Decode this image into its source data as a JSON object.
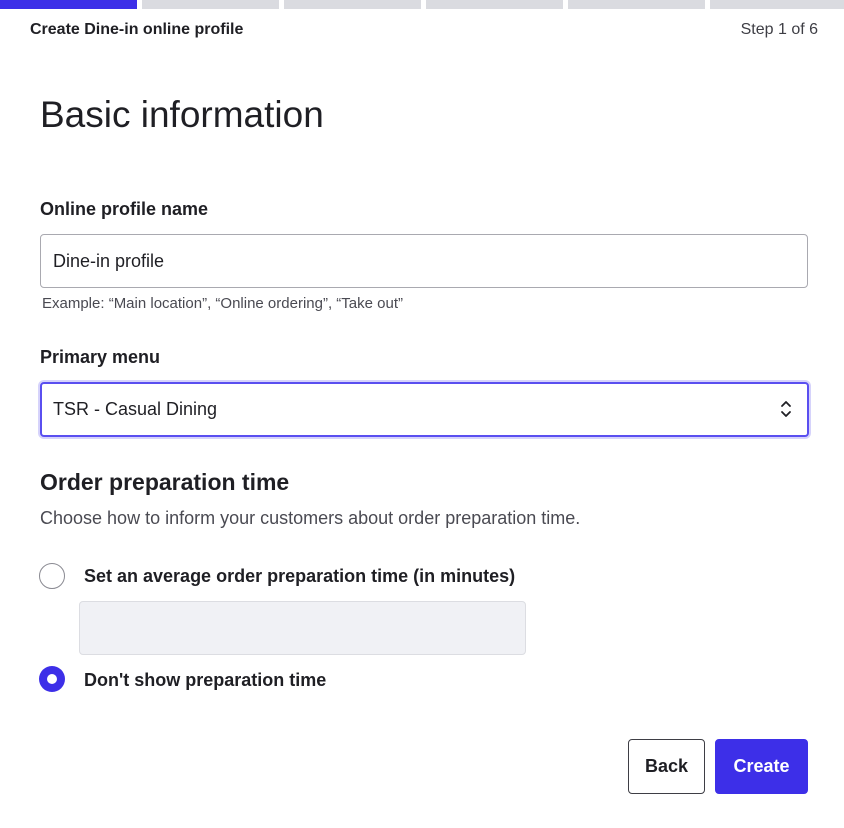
{
  "progress": {
    "total_steps": 6,
    "current_step": 1
  },
  "header": {
    "title": "Create Dine-in online profile",
    "step_label": "Step 1 of 6"
  },
  "heading": "Basic information",
  "profile_name": {
    "label": "Online profile name",
    "value": "Dine-in profile",
    "helper": "Example: “Main location”, “Online ordering”, “Take out”"
  },
  "primary_menu": {
    "label": "Primary menu",
    "selected": "TSR - Casual Dining"
  },
  "prep_time": {
    "title": "Order preparation time",
    "description": "Choose how to inform your customers about order preparation time.",
    "option_average": "Set an average order preparation time (in minutes)",
    "minutes_value": "",
    "option_hide": "Don't show preparation time",
    "selected_option": "option_hide"
  },
  "actions": {
    "back": "Back",
    "create": "Create"
  },
  "colors": {
    "accent": "#3d2fe8",
    "segment_inactive": "#dadbe0"
  }
}
